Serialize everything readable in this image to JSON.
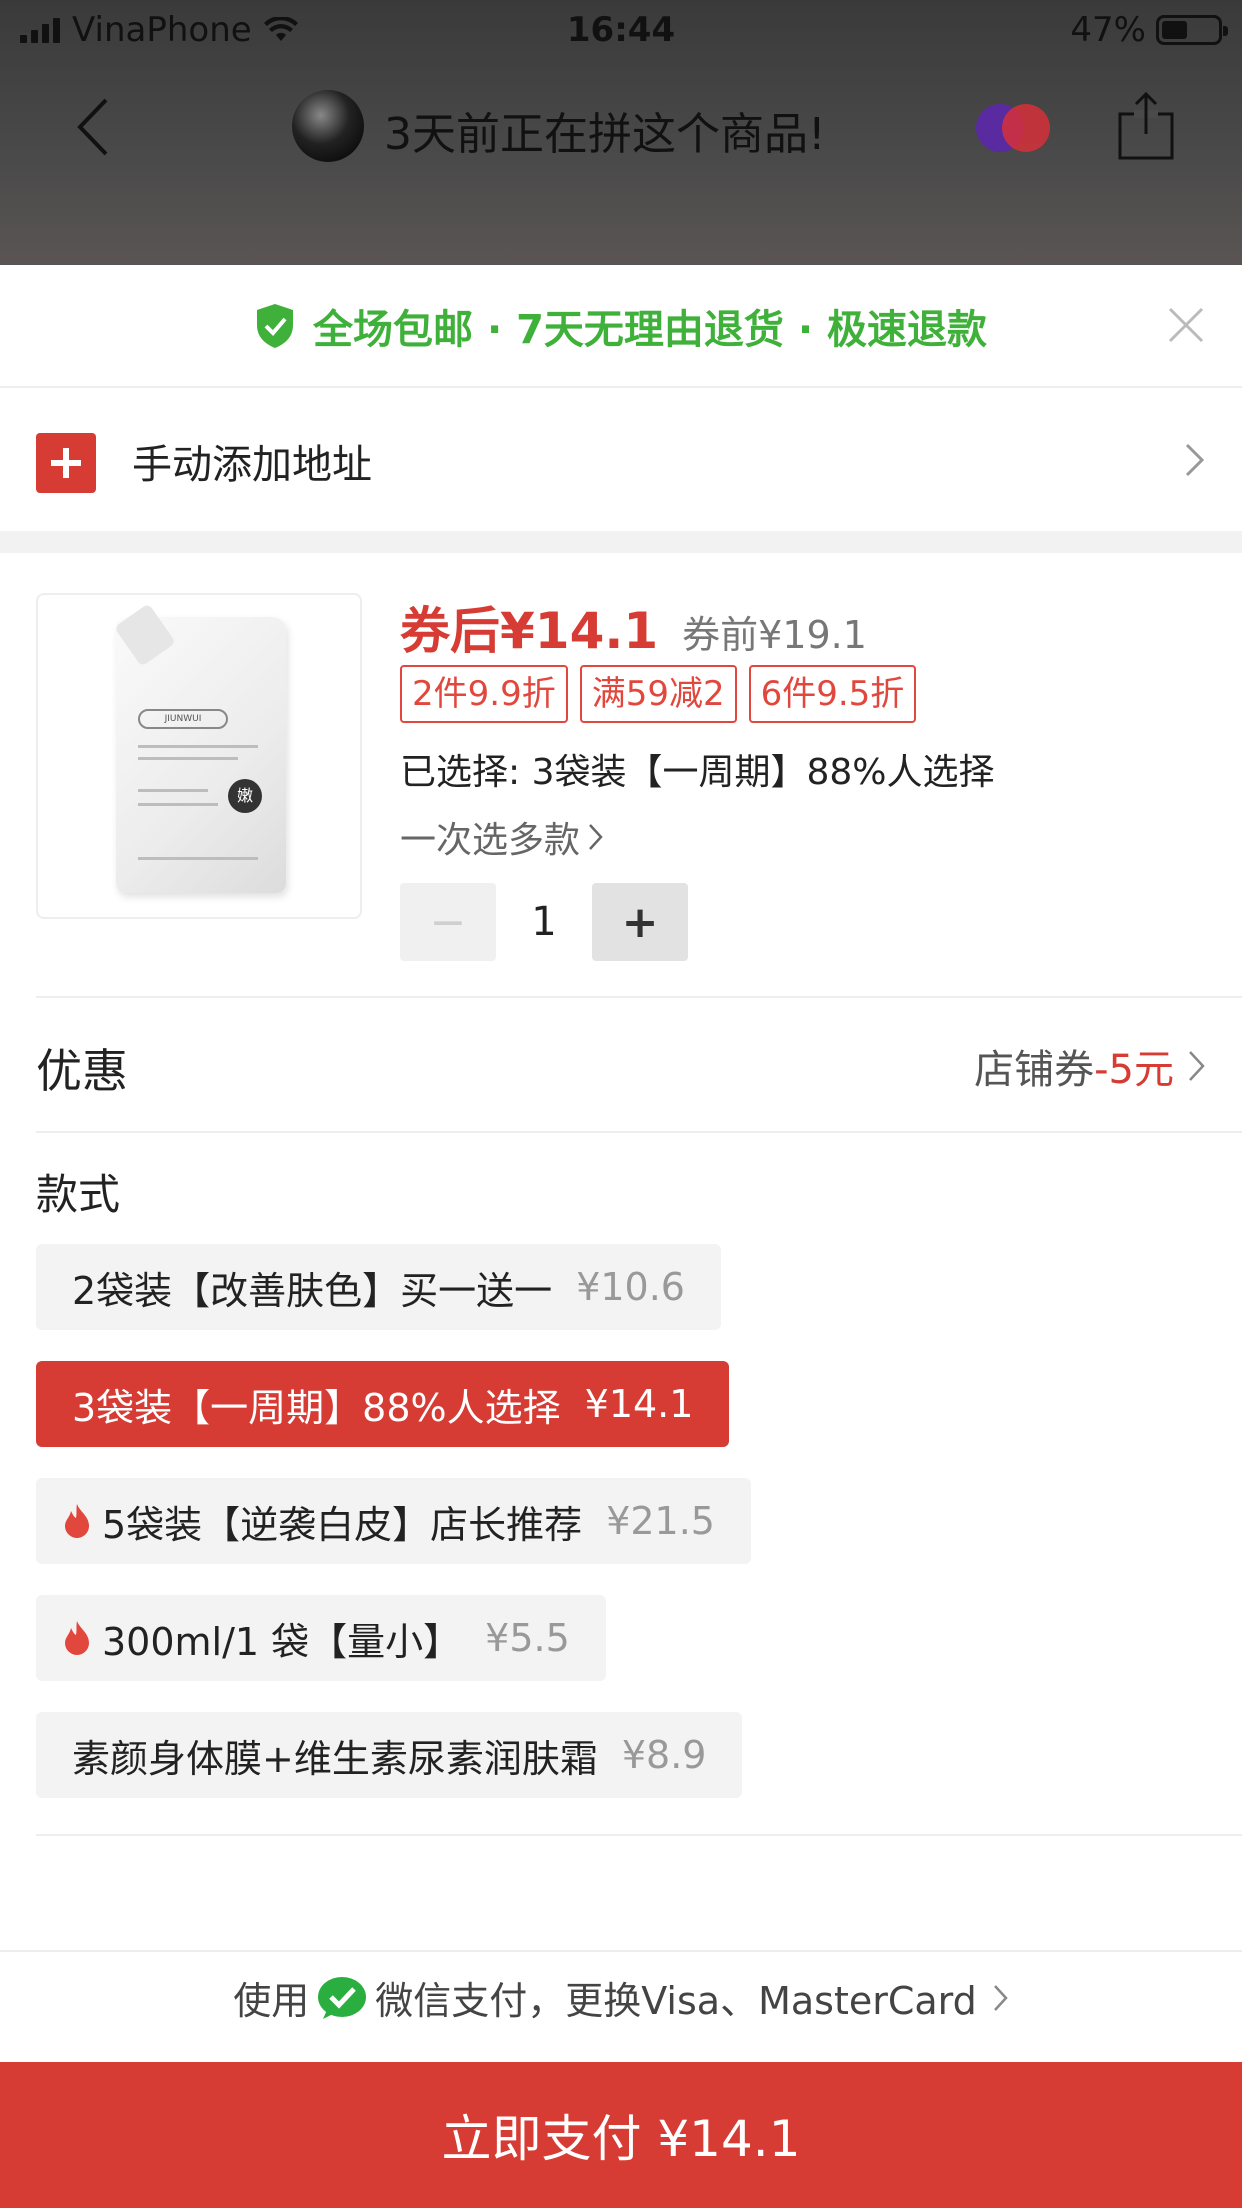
{
  "status_bar": {
    "carrier": "VinaPhone",
    "time": "16:44",
    "battery": "47%"
  },
  "nav": {
    "title": "3天前正在拼这个商品!"
  },
  "sheet": {
    "guarantee_text": "全场包邮 · 7天无理由退货 · 极速退款",
    "address_label": "手动添加地址",
    "product": {
      "price_after": "券后¥14.1",
      "price_before": "券前¥19.1",
      "promo_tags": [
        "2件9.9折",
        "满59减2",
        "6件9.5折"
      ],
      "selected": "已选择: 3袋装【一周期】88%人选择",
      "multi_select": "一次选多款",
      "quantity": "1",
      "minus": "−",
      "plus": "+"
    },
    "coupon": {
      "label": "优惠",
      "store_coupon": "店铺券",
      "discount": "-5元"
    },
    "style": {
      "title": "款式",
      "options": [
        {
          "label": "2袋装【改善肤色】买一送一",
          "price": "¥10.6",
          "active": false,
          "hot": false
        },
        {
          "label": "3袋装【一周期】88%人选择",
          "price": "¥14.1",
          "active": true,
          "hot": false
        },
        {
          "label": "5袋装【逆袭白皮】店长推荐",
          "price": "¥21.5",
          "active": false,
          "hot": true
        },
        {
          "label": "300ml/1 袋【量小】",
          "price": "¥5.5",
          "active": false,
          "hot": true
        },
        {
          "label": "素颜身体膜+维生素尿素润肤霜",
          "price": "¥8.9",
          "active": false,
          "hot": false
        }
      ]
    },
    "payment": {
      "prefix": "使用",
      "method": "微信支付，更换Visa、MasterCard",
      "pay_button": "立即支付 ¥14.1"
    }
  },
  "colors": {
    "accent_red": "#d63b34",
    "guarantee_green": "#3fb03a",
    "wechat_green": "#2aae3f"
  }
}
